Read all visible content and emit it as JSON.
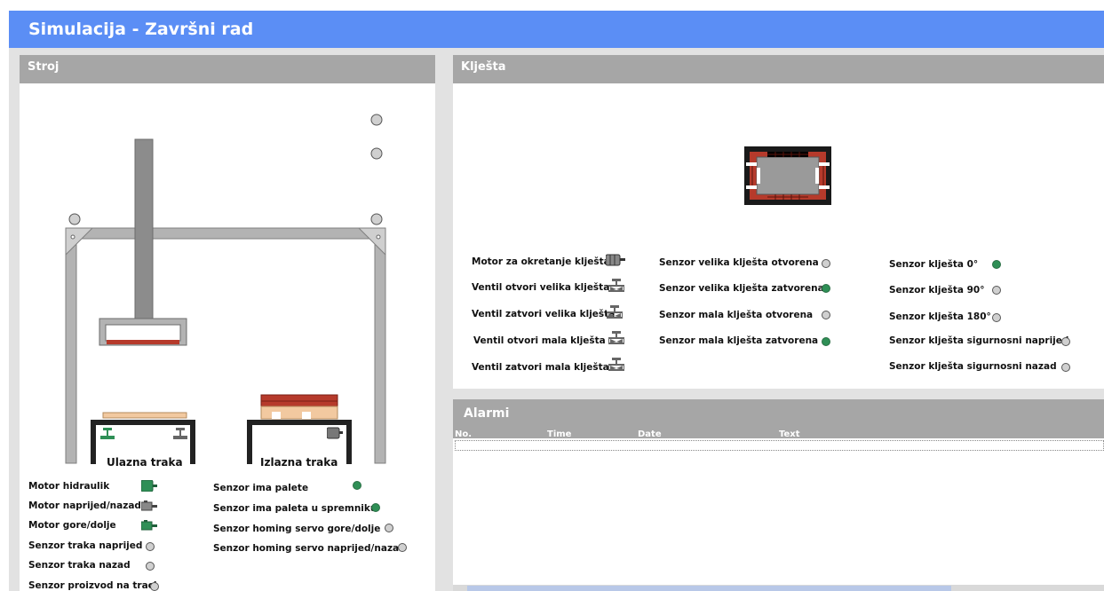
{
  "app": {
    "title": "Simulacija - Završni rad"
  },
  "stroj": {
    "title": "Stroj",
    "conveyor_in": "Ulazna traka",
    "conveyor_out": "Izlazna traka",
    "items": [
      {
        "label": "Motor hidraulik",
        "kind": "motor",
        "state": "on"
      },
      {
        "label": "Motor naprijed/nazad",
        "kind": "motor",
        "state": "off"
      },
      {
        "label": "Motor gore/dolje",
        "kind": "motor",
        "state": "on"
      },
      {
        "label": "Senzor traka naprijed",
        "kind": "sensor",
        "state": "off"
      },
      {
        "label": "Senzor traka nazad",
        "kind": "sensor",
        "state": "off"
      },
      {
        "label": "Senzor proizvod na traci",
        "kind": "sensor",
        "state": "off"
      },
      {
        "label": "Senzor ima palete",
        "kind": "sensor",
        "state": "on"
      },
      {
        "label": "Senzor ima paleta u spremniku",
        "kind": "sensor",
        "state": "on"
      },
      {
        "label": "Senzor homing servo gore/dolje",
        "kind": "sensor",
        "state": "off"
      },
      {
        "label": "Senzor homing servo naprijed/nazad",
        "kind": "sensor",
        "state": "off"
      }
    ]
  },
  "klijesta": {
    "title": "Klješta",
    "items": [
      {
        "label": "Motor za okretanje klješta",
        "kind": "motor",
        "state": "off"
      },
      {
        "label": "Ventil otvori velika klješta",
        "kind": "valve",
        "state": "off"
      },
      {
        "label": "Ventil zatvori velika klješta",
        "kind": "valve",
        "state": "off"
      },
      {
        "label": "Ventil otvori mala klješta",
        "kind": "valve",
        "state": "off"
      },
      {
        "label": "Ventil zatvori mala klješta",
        "kind": "valve",
        "state": "off"
      },
      {
        "label": "Senzor velika klješta otvorena",
        "kind": "sensor",
        "state": "off"
      },
      {
        "label": "Senzor velika klješta zatvorena",
        "kind": "sensor",
        "state": "on"
      },
      {
        "label": "Senzor mala klješta otvorena",
        "kind": "sensor",
        "state": "off"
      },
      {
        "label": "Senzor mala klješta zatvorena",
        "kind": "sensor",
        "state": "on"
      },
      {
        "label": "Senzor klješta 0°",
        "kind": "sensor",
        "state": "on"
      },
      {
        "label": "Senzor klješta 90°",
        "kind": "sensor",
        "state": "off"
      },
      {
        "label": "Senzor klješta 180°",
        "kind": "sensor",
        "state": "off"
      },
      {
        "label": "Senzor klješta sigurnosni naprijed",
        "kind": "sensor",
        "state": "off"
      },
      {
        "label": "Senzor klješta sigurnosni nazad",
        "kind": "sensor",
        "state": "off"
      }
    ]
  },
  "alarmi": {
    "title": "Alarmi",
    "columns": [
      "No.",
      "Time",
      "Date",
      "Text"
    ]
  },
  "colors": {
    "header": "#5b8ef5",
    "panel_head": "#a6a6a6",
    "on": "#2f8f56",
    "off": "#d0d0d0"
  }
}
